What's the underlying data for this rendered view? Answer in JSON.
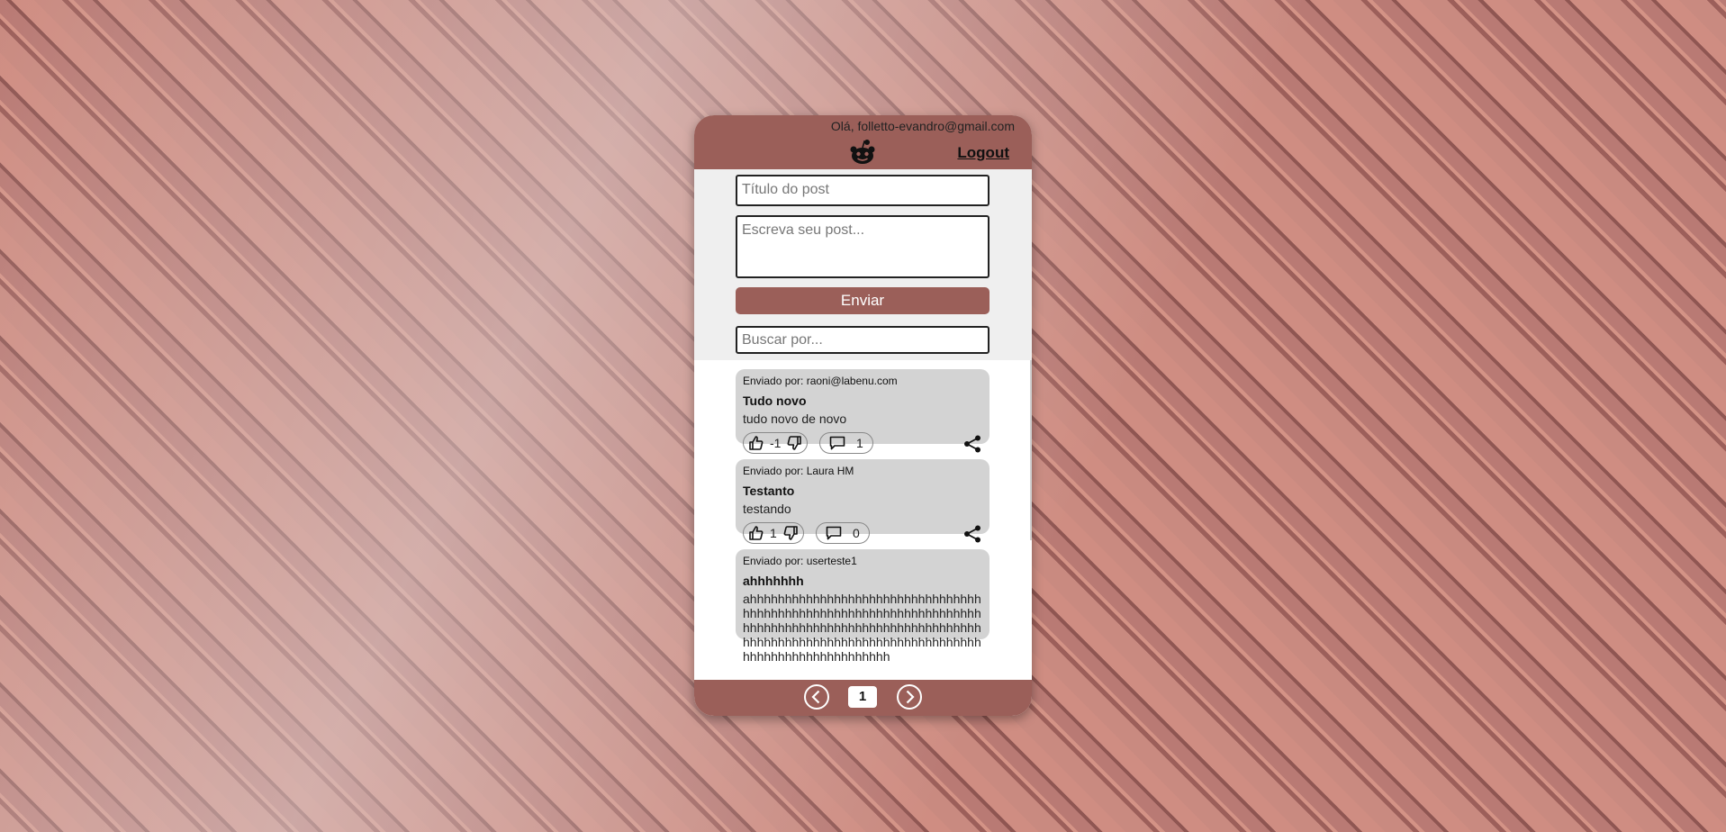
{
  "header": {
    "greeting": "Olá, folletto-evandro@gmail.com",
    "logo_icon": "reddit-alien-icon",
    "logout_label": "Logout"
  },
  "form": {
    "title_placeholder": "Título do post",
    "body_placeholder": "Escreva seu post...",
    "send_label": "Enviar",
    "search_placeholder": "Buscar por..."
  },
  "posts": [
    {
      "author": "Enviado por: raoni@labenu.com",
      "title": "Tudo novo",
      "body": "tudo novo de novo",
      "votes": "-1",
      "comments": "1"
    },
    {
      "author": "Enviado por: Laura HM",
      "title": "Testanto",
      "body": "testando",
      "votes": "1",
      "comments": "0"
    },
    {
      "author": "Enviado por: userteste1",
      "title": "ahhhhhhh",
      "body": "ahhhhhhhhhhhhhhhhhhhhhhhhhhhhhhhhhhhhhhhhhhhhhhhhhhhhhhhhhhhhhhhhhhhhhhhhhhhhhhhhhhhhhhhhhhhhhhhhhhhhhhhhhhhhhhhhhhhhhhhhhhhhhhhhhhhhhhhhhhhhhhhhhhhhhhhhhhhh",
      "votes": "",
      "comments": ""
    }
  ],
  "pagination": {
    "current_page": "1",
    "prev_icon": "chevron-left-circle-icon",
    "next_icon": "chevron-right-circle-icon"
  },
  "colors": {
    "brand": "#9b5f59",
    "card": "#d3d3d3",
    "form_bg": "#efefef"
  }
}
